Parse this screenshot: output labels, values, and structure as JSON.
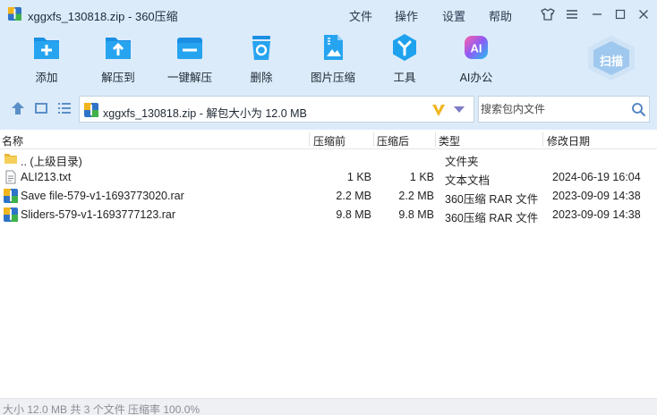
{
  "window": {
    "title": "xggxfs_130818.zip - 360压缩",
    "menu": [
      "文件",
      "操作",
      "设置",
      "帮助"
    ]
  },
  "toolbar": [
    {
      "label": "添加",
      "icon": "add-icon"
    },
    {
      "label": "解压到",
      "icon": "extract-to-icon"
    },
    {
      "label": "一键解压",
      "icon": "one-click-extract-icon"
    },
    {
      "label": "删除",
      "icon": "delete-icon"
    },
    {
      "label": "图片压缩",
      "icon": "image-compress-icon"
    },
    {
      "label": "工具",
      "icon": "tools-icon"
    },
    {
      "label": "AI办公",
      "icon": "ai-office-icon"
    }
  ],
  "scan": {
    "label": "扫描"
  },
  "path": {
    "text": "xggxfs_130818.zip - 解包大小为 12.0 MB"
  },
  "search": {
    "placeholder": "搜索包内文件"
  },
  "columns": {
    "name": "名称",
    "before": "压缩前",
    "after": "压缩后",
    "type": "类型",
    "modified": "修改日期"
  },
  "rows": [
    {
      "name": ".. (上级目录)",
      "before": "",
      "after": "",
      "type": "文件夹",
      "modified": "",
      "icon": "folder-icon"
    },
    {
      "name": "ALI213.txt",
      "before": "1 KB",
      "after": "1 KB",
      "type": "文本文档",
      "modified": "2024-06-19 16:04",
      "icon": "text-file-icon"
    },
    {
      "name": "Save file-579-v1-1693773020.rar",
      "before": "2.2 MB",
      "after": "2.2 MB",
      "type": "360压缩 RAR 文件",
      "modified": "2023-09-09 14:38",
      "icon": "rar-file-icon"
    },
    {
      "name": "Sliders-579-v1-1693777123.rar",
      "before": "9.8 MB",
      "after": "9.8 MB",
      "type": "360压缩 RAR 文件",
      "modified": "2023-09-09 14:38",
      "icon": "rar-file-icon"
    }
  ],
  "status": {
    "text": "大小 12.0 MB 共 3 个文件 压缩率 100.0%"
  },
  "colors": {
    "accent": "#1a9be8",
    "toolbar_bg": "#dcebfa"
  }
}
